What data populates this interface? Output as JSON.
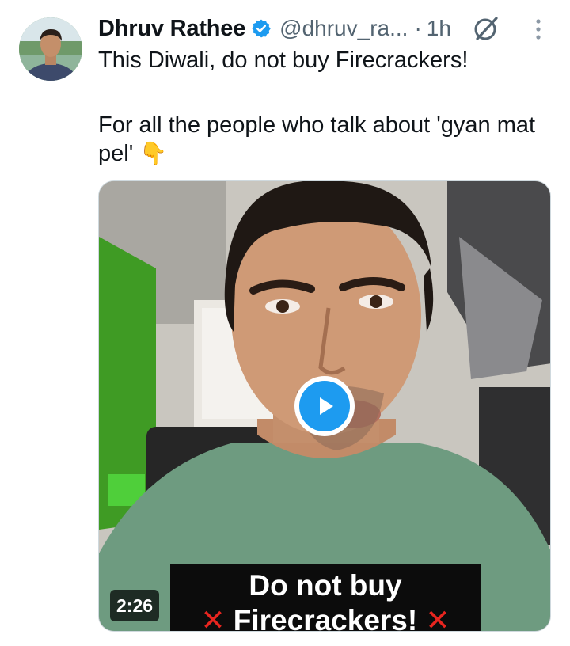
{
  "author": {
    "display_name": "Dhruv Rathee",
    "handle": "@dhruv_ra...",
    "separator": "·",
    "time": "1h",
    "verified": true,
    "verified_color": "#1d9bf0"
  },
  "tweet": {
    "line1": "This Diwali, do not buy Firecrackers!",
    "line2": "For all the people who talk about 'gyan mat pel'",
    "emoji": "👇"
  },
  "media": {
    "type": "video",
    "duration": "2:26",
    "caption_line1": "Do not buy",
    "caption_line2": "Firecrackers!",
    "caption_mark": "✕",
    "play_color": "#1d9bf0"
  },
  "icons": {
    "grok": "grok-icon",
    "more": "more-options-icon",
    "play": "play-icon"
  }
}
